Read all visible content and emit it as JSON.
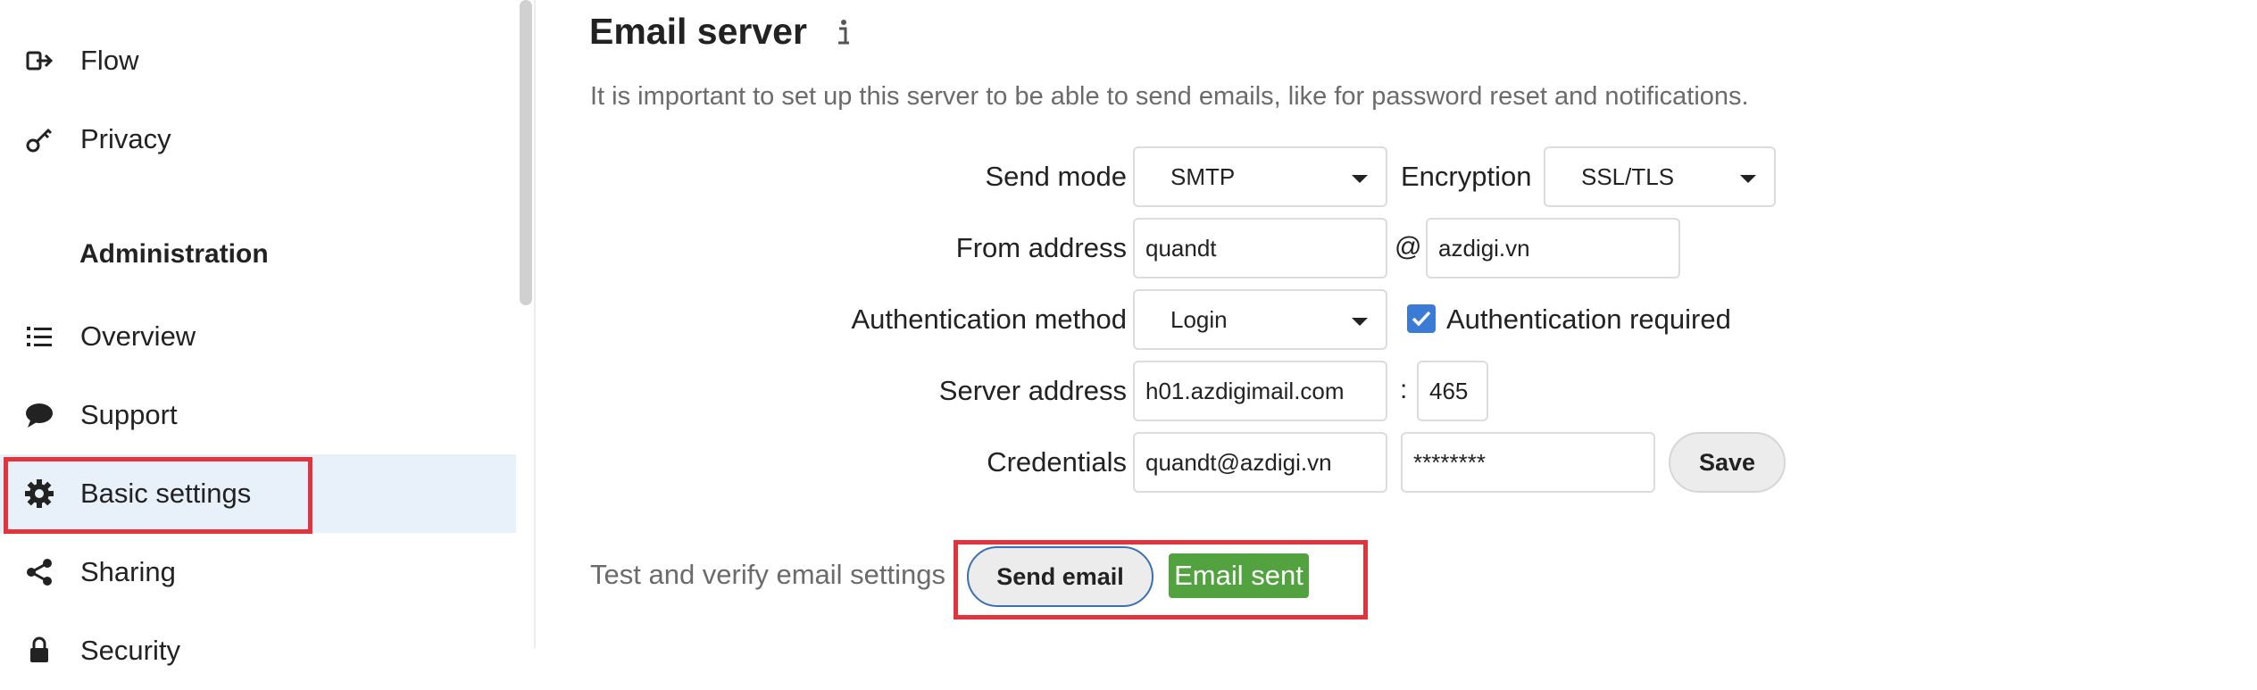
{
  "sidebar": {
    "items_top": [
      {
        "label": "Flow",
        "icon": "flow-icon"
      },
      {
        "label": "Privacy",
        "icon": "key-icon"
      }
    ],
    "section_title": "Administration",
    "items_admin": [
      {
        "label": "Overview",
        "icon": "list-icon"
      },
      {
        "label": "Support",
        "icon": "chat-bubble-icon"
      },
      {
        "label": "Basic settings",
        "icon": "gear-icon"
      },
      {
        "label": "Sharing",
        "icon": "share-icon"
      },
      {
        "label": "Security",
        "icon": "lock-icon"
      }
    ],
    "active_item": "Basic settings"
  },
  "email_server": {
    "title": "Email server",
    "info_icon": "info-icon",
    "description": "It is important to set up this server to be able to send emails, like for password reset and notifications.",
    "send_mode": {
      "label": "Send mode",
      "value": "SMTP"
    },
    "encryption": {
      "label": "Encryption",
      "value": "SSL/TLS"
    },
    "from_address": {
      "label": "From address",
      "user": "quandt",
      "at": "@",
      "domain": "azdigi.vn"
    },
    "auth_method": {
      "label": "Authentication method",
      "value": "Login"
    },
    "auth_required": {
      "label": "Authentication required",
      "checked": true
    },
    "server_address": {
      "label": "Server address",
      "host": "h01.azdigimail.com",
      "colon": ":",
      "port": "465"
    },
    "credentials": {
      "label": "Credentials",
      "username": "quandt@azdigi.vn",
      "password": "********"
    },
    "save_label": "Save",
    "test_text": "Test and verify email settings",
    "send_email_label": "Send email",
    "status_badge": "Email sent"
  },
  "colors": {
    "highlight_border": "#e2343d",
    "active_bg": "#e8f1fa",
    "success_badge": "#52a33f",
    "checkbox": "#3a7bd5"
  }
}
